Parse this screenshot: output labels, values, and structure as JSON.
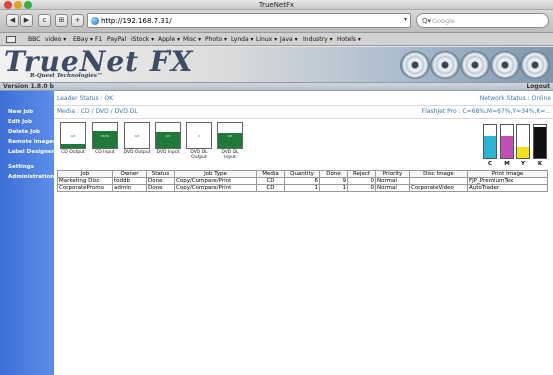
{
  "window": {
    "title": "TrueNetFx"
  },
  "toolbar": {
    "back": "◀",
    "forward": "▶",
    "reload": "c",
    "rss": "⊞",
    "add": "+",
    "url": "http://192.168.7.31/",
    "search_placeholder": "Google"
  },
  "bookmarks": [
    "BBC",
    "video ▾",
    "EBay ▾",
    "F1",
    "PayPal",
    "iStock ▾",
    "Apple ▾",
    "Misc ▾",
    "Photo ▾",
    "Lynda ▾",
    "Linux ▾",
    "Java ▾",
    "Industry ▾",
    "Hotels ▾"
  ],
  "header": {
    "logo": "TrueNet FX",
    "trademark": "™",
    "tagline": "R-Quest Technologies™",
    "version": "Version 1.8.0 b",
    "logout": "Logout"
  },
  "sidebar": {
    "items": [
      "New Job",
      "Edit Job",
      "Delete Job",
      "Remote Images",
      "Label Designer",
      "Settings",
      "Administration"
    ]
  },
  "status": {
    "leader": "Leader Status : OK",
    "network": "Network Status : Online",
    "media": "Media : CD / DVD / DVD DL",
    "flashjet": "FlashJet Pro : C=68%,M=67%,Y=34%,K=..."
  },
  "gauges": [
    {
      "caption": "CD Output",
      "level": 0.15,
      "label": "0/0"
    },
    {
      "caption": "CD Input",
      "level": 0.7,
      "label": "56/59"
    },
    {
      "caption": "DVD Output",
      "level": 0.0,
      "label": "0/0"
    },
    {
      "caption": "DVD Input",
      "level": 0.65,
      "label": "0/0"
    },
    {
      "caption": "DVD DL Output",
      "level": 0.0,
      "label": "0"
    },
    {
      "caption": "DVD DL Input",
      "level": 0.6,
      "label": "0/0"
    }
  ],
  "inks": [
    {
      "label": "C",
      "level": 0.68,
      "color": "#2ab4d8"
    },
    {
      "label": "M",
      "level": 0.67,
      "color": "#c24fb5"
    },
    {
      "label": "Y",
      "level": 0.34,
      "color": "#f2e21a"
    },
    {
      "label": "K",
      "level": 0.95,
      "color": "#111111"
    }
  ],
  "jobs": {
    "columns": [
      "Job",
      "Owner",
      "Status",
      "Job Type",
      "Media",
      "Quantity",
      "Done",
      "Reject",
      "Priority",
      "Disc Image",
      "Print Image"
    ],
    "rows": [
      [
        "Marketing Disc",
        "toddb",
        "Done",
        "Copy/Compare/Print",
        "CD",
        "6",
        "9",
        "0",
        "Normal",
        "",
        "FJP_PremiumTex"
      ],
      [
        "CorporatePromo",
        "admin",
        "Done",
        "Copy/Compare/Print",
        "CD",
        "1",
        "1",
        "0",
        "Normal",
        "CorporateVideo",
        "AutoTrader"
      ]
    ]
  }
}
